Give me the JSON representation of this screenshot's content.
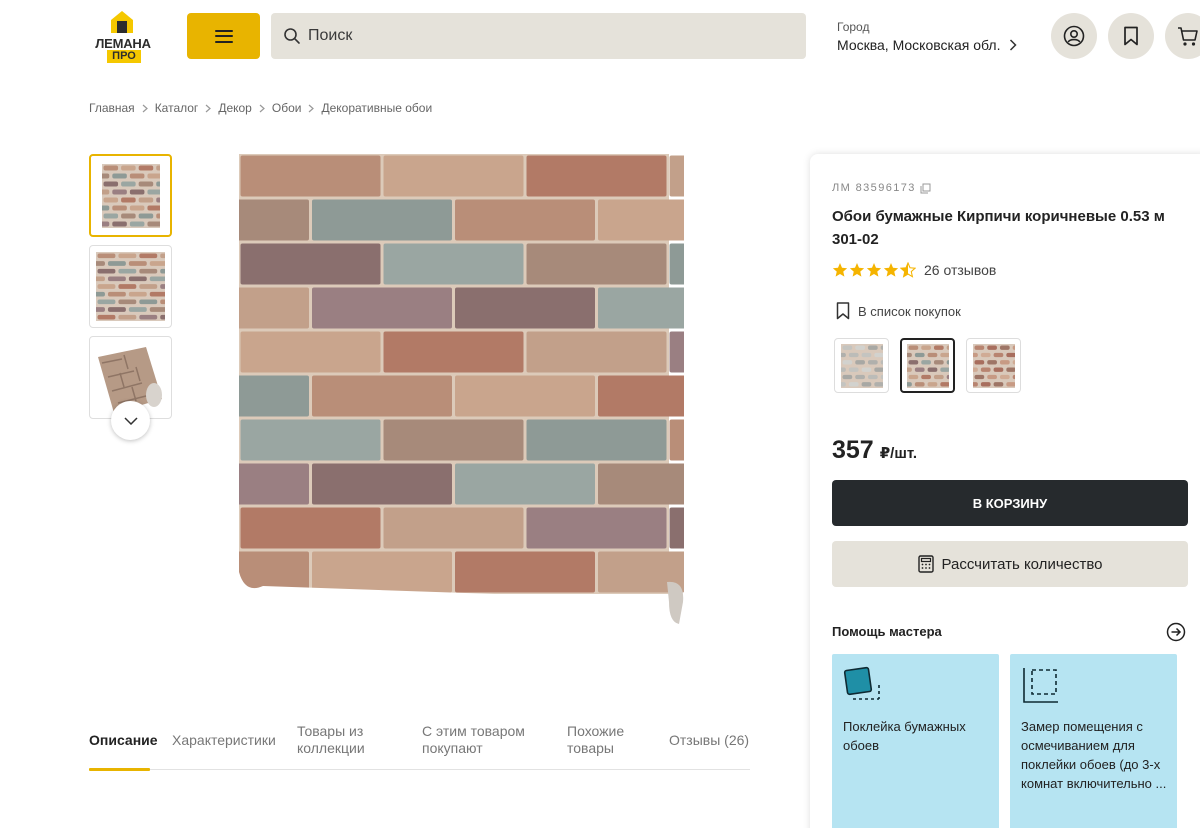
{
  "header": {
    "logo": {
      "word": "ЛЕМАНА",
      "sub": "ПРО"
    },
    "search": {
      "placeholder": "Поиск",
      "value": ""
    },
    "city": {
      "label": "Город",
      "value": "Москва, Московская обл."
    }
  },
  "breadcrumb": [
    "Главная",
    "Каталог",
    "Декор",
    "Обои",
    "Декоративные обои"
  ],
  "tabs": [
    {
      "label": "Описание",
      "active": true
    },
    {
      "label": "Характеристики"
    },
    {
      "label": "Товары из коллекции"
    },
    {
      "label": "С этим товаром покупают"
    },
    {
      "label": "Похожие товары"
    },
    {
      "label": "Отзывы (26)"
    }
  ],
  "product": {
    "sku": "ЛМ 83596173",
    "title": "Обои бумажные Кирпичи коричневые 0.53 м 301-02",
    "rating": 4.5,
    "reviews": "26 отзывов",
    "shopping_list": "В список покупок",
    "price": "357",
    "price_unit": "₽/шт.",
    "cart_button": "В КОРЗИНУ",
    "calc_button": "Рассчитать количество"
  },
  "help": {
    "title": "Помощь мастера",
    "services": [
      {
        "text": "Поклейка бумажных обоев"
      },
      {
        "text": "Замер помещения с осмечиванием для поклейки обоев (до 3-х комнат включительно ..."
      }
    ]
  },
  "colors": {
    "accent": "#e8b400",
    "dark": "#262a2d",
    "surface": "#e5e2da",
    "service": "#b6e4f2"
  }
}
